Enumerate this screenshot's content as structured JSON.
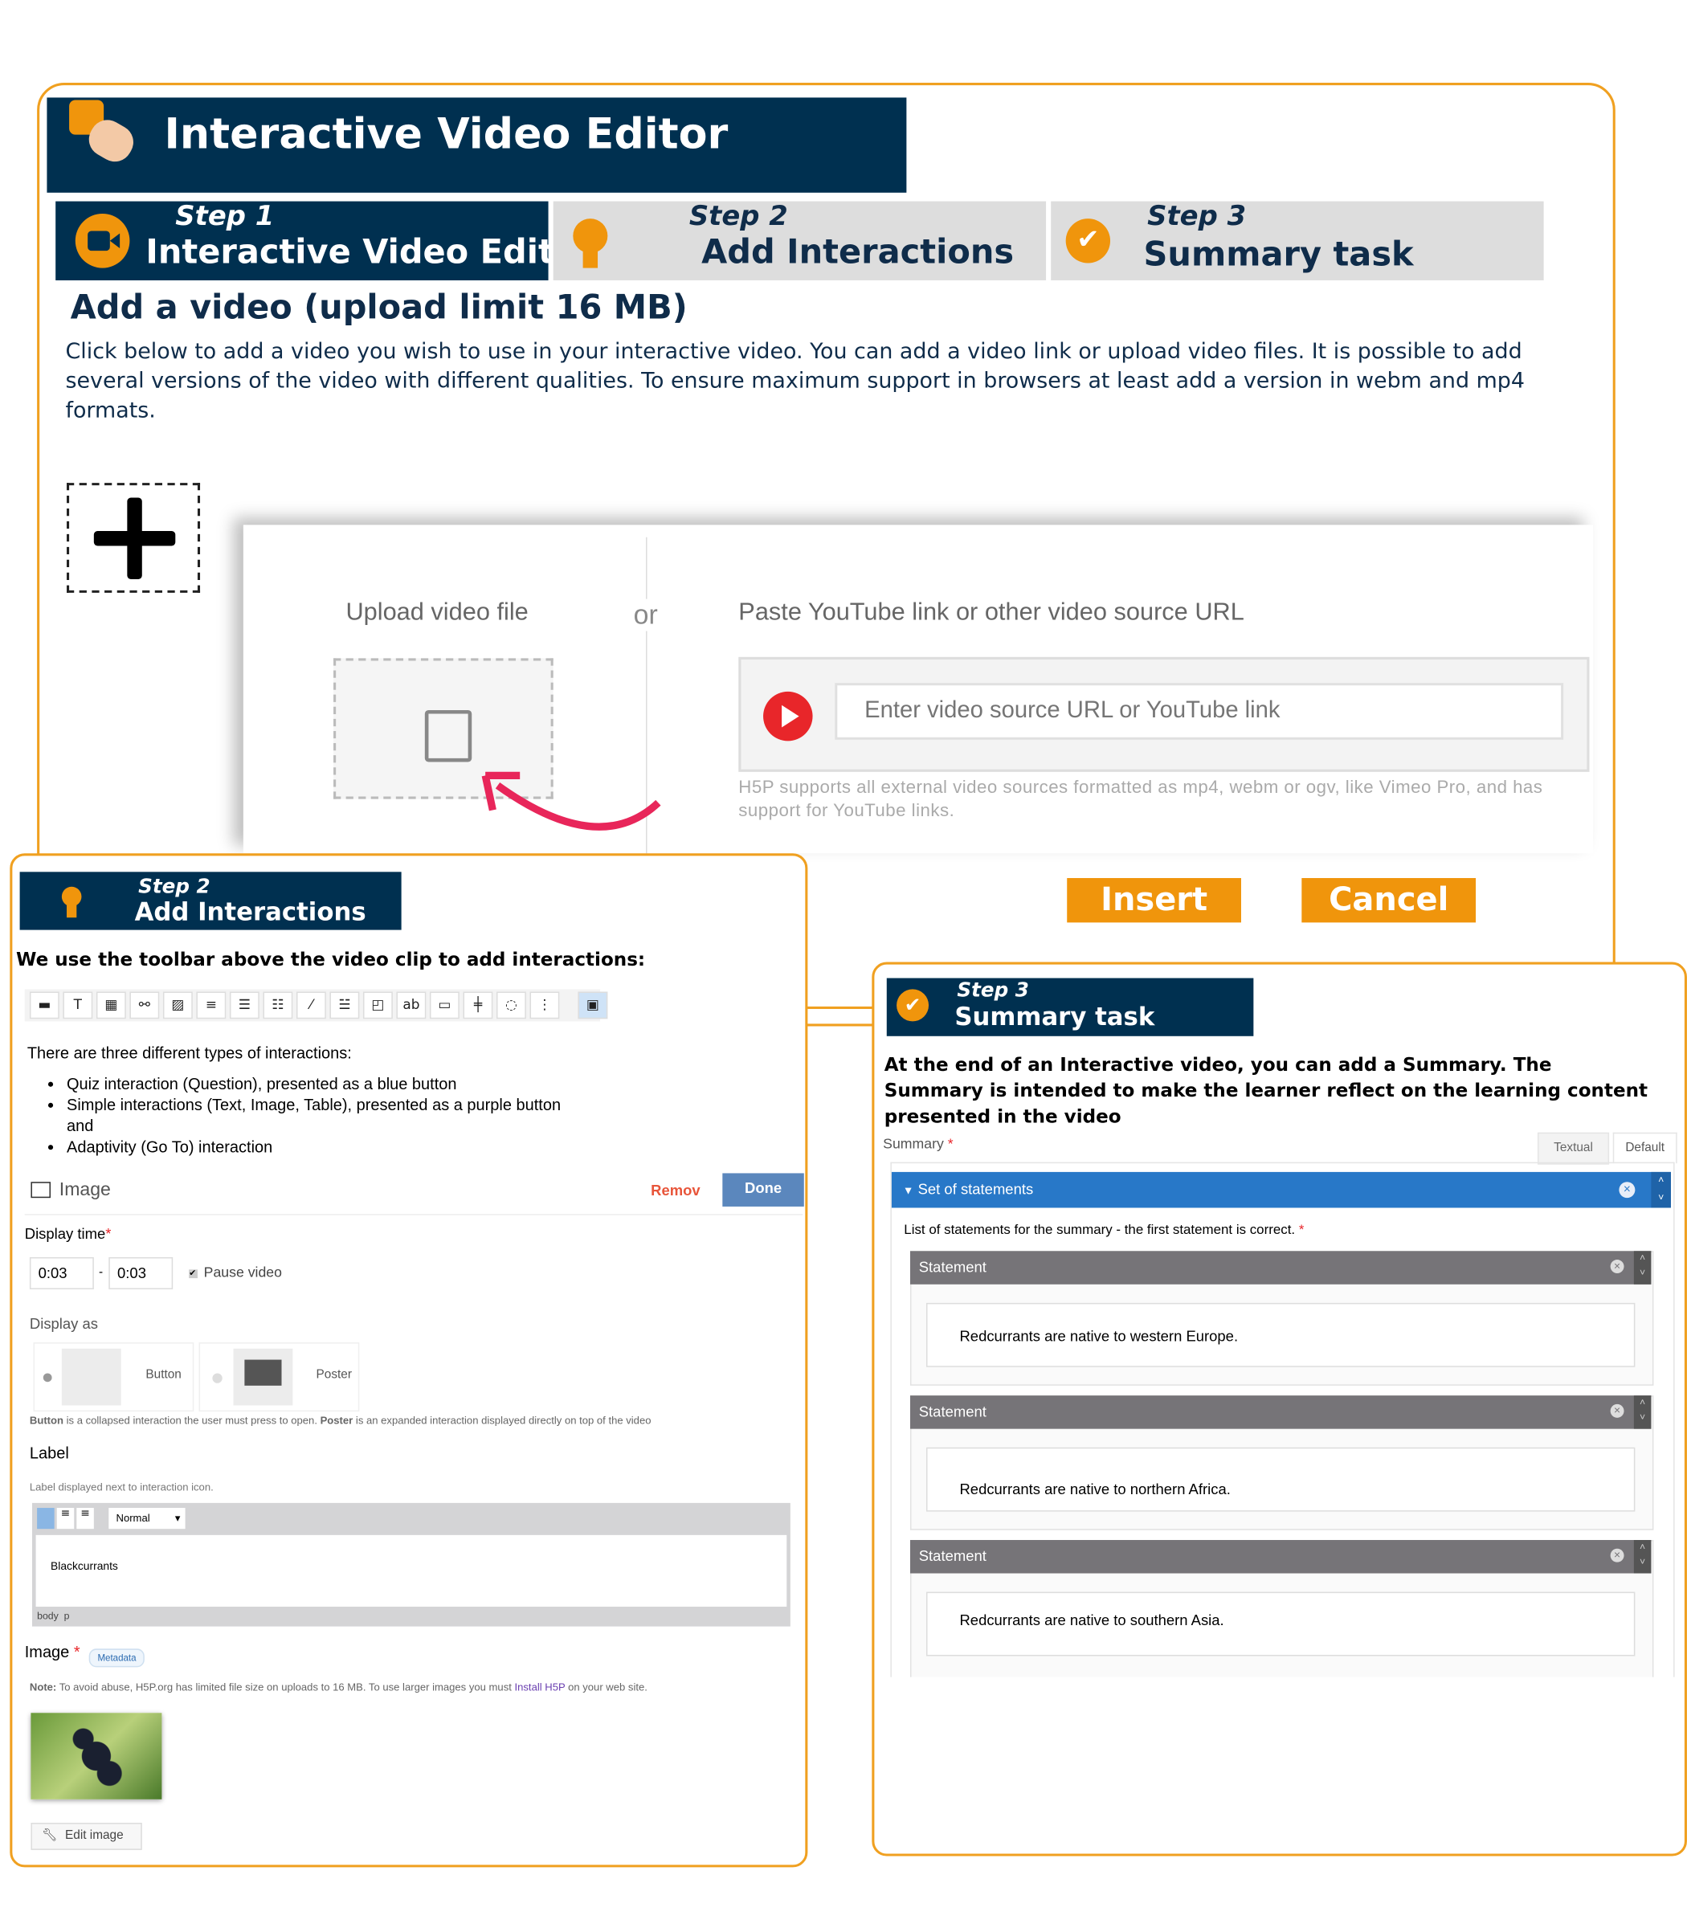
{
  "header": {
    "title": "Interactive Video Editor"
  },
  "steps": [
    {
      "num": "Step 1",
      "label": "Interactive Video Editor"
    },
    {
      "num": "Step 2",
      "label": "Add Interactions"
    },
    {
      "num": "Step 3",
      "label": "Summary task"
    }
  ],
  "main": {
    "heading": "Add a video (upload limit 16 MB)",
    "description": "Click below to add a video you wish to use in your interactive video. You can add a video link or upload video files. It is possible to add several versions of the video with different qualities. To ensure maximum support in browsers at least add a version in webm and mp4 formats."
  },
  "upload": {
    "upload_label": "Upload video file",
    "or": "or",
    "url_label": "Paste YouTube link or other video source URL",
    "url_placeholder": "Enter video source URL or YouTube link",
    "help": "H5P supports all external video sources formatted as mp4, webm or ogv, like Vimeo Pro, and has support for YouTube links.",
    "insert": "Insert",
    "cancel": "Cancel"
  },
  "step2_panel": {
    "num": "Step 2",
    "label": "Add Interactions",
    "intro": "We use the toolbar above the video clip to add interactions:",
    "types_intro": "There are three different types of interactions:",
    "bullets": [
      "Quiz interaction (Question), presented as a blue button",
      "Simple interactions (Text, Image, Table), presented as a purple button and",
      "Adaptivity (Go To) interaction"
    ],
    "editor_title": "Image",
    "remove": "Remov",
    "done": "Done",
    "display_time_label": "Display time",
    "time_from": "0:03",
    "time_sep": "-",
    "time_to": "0:03",
    "pause_video": "Pause video",
    "display_as_label": "Display as",
    "opt_button": "Button",
    "opt_poster": "Poster",
    "display_help_b1": "Button",
    "display_help_t1": " is a collapsed interaction the user must press to open. ",
    "display_help_b2": "Poster",
    "display_help_t2": " is an expanded interaction displayed directly on top of the video",
    "label_label": "Label",
    "label_help": "Label displayed next to interaction icon.",
    "format_select": "Normal",
    "label_value": "Blackcurrants",
    "path": "body  p",
    "image_label": "Image",
    "metadata": "Metadata",
    "note_b": "Note:",
    "note_t": " To avoid abuse, H5P.org has limited file size on uploads to 16 MB. To use larger images you must ",
    "note_link": "Install H5P",
    "note_end": " on your web site.",
    "edit_image": "Edit image"
  },
  "step3_panel": {
    "num": "Step 3",
    "label": "Summary task",
    "intro": "At the end of an Interactive video, you can add a Summary. The Summary is intended to make the learner reflect on the learning content presented in the video",
    "summary_label": "Summary",
    "tab_textual": "Textual",
    "tab_default": "Default",
    "set_label": "Set of statements",
    "list_label": "List of statements for the summary - the first statement is correct.",
    "statement_header": "Statement",
    "statements": [
      "Redcurrants are native to western Europe.",
      "Redcurrants are native to northern Africa.",
      "Redcurrants are native to southern Asia."
    ]
  },
  "colors": {
    "navy": "#003050",
    "orange": "#f0950c",
    "blue": "#2878c8",
    "red": "#e8262a"
  }
}
